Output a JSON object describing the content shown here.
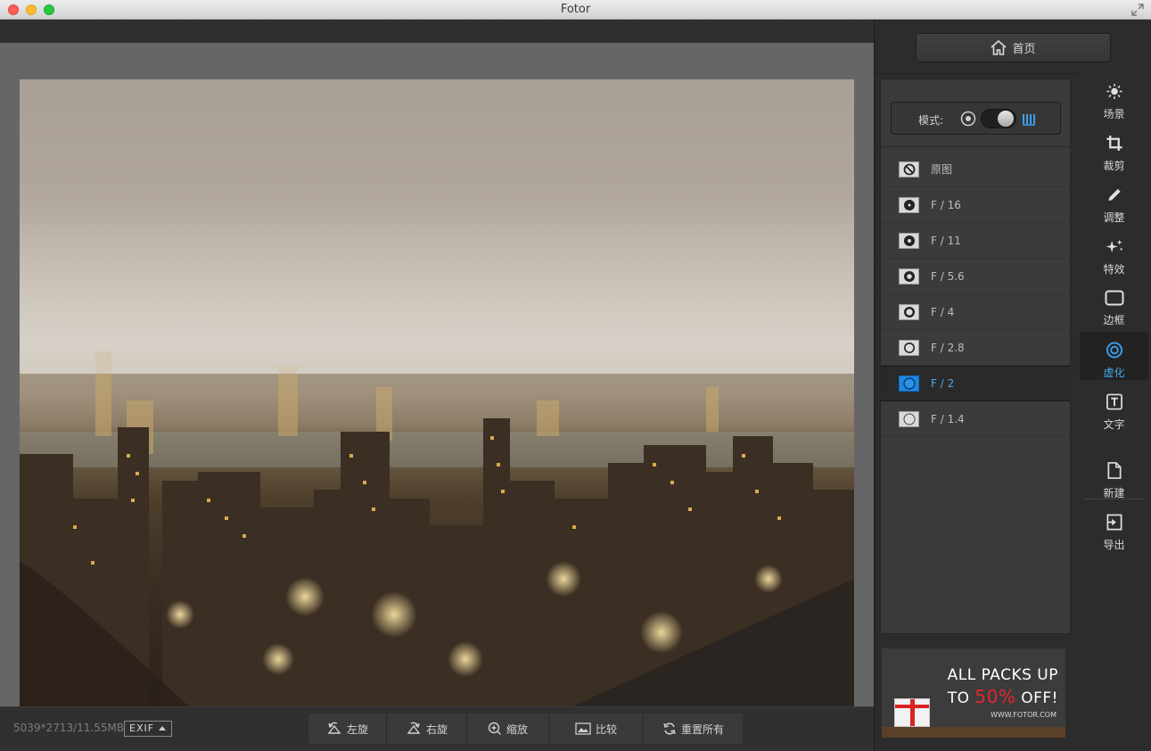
{
  "window": {
    "title": "Fotor"
  },
  "home_button": {
    "label": "首页"
  },
  "mode": {
    "label": "模式:"
  },
  "options": [
    {
      "label": "原图",
      "icon": "no-blur-icon"
    },
    {
      "label": "F / 16",
      "icon": "aperture-icon"
    },
    {
      "label": "F / 11",
      "icon": "aperture-icon"
    },
    {
      "label": "F / 5.6",
      "icon": "aperture-icon"
    },
    {
      "label": "F / 4",
      "icon": "aperture-icon"
    },
    {
      "label": "F / 2.8",
      "icon": "aperture-icon"
    },
    {
      "label": "F / 2",
      "icon": "aperture-icon",
      "active": true
    },
    {
      "label": "F / 1.4",
      "icon": "aperture-icon"
    }
  ],
  "nav": [
    {
      "label": "场景",
      "icon": "sun-icon"
    },
    {
      "label": "裁剪",
      "icon": "crop-icon"
    },
    {
      "label": "调整",
      "icon": "pencil-icon"
    },
    {
      "label": "特效",
      "icon": "sparkle-icon"
    },
    {
      "label": "边框",
      "icon": "frame-icon"
    },
    {
      "label": "虚化",
      "icon": "blur-icon",
      "active": true
    },
    {
      "label": "文字",
      "icon": "text-icon"
    },
    {
      "label": "新建",
      "icon": "new-file-icon"
    },
    {
      "label": "导出",
      "icon": "export-icon"
    }
  ],
  "bottom": {
    "file_info": "5039*2713/11.55MB",
    "exif_label": "EXIF",
    "rotate_left": "左旋",
    "rotate_right": "右旋",
    "zoom": "缩放",
    "compare": "比较",
    "reset_all": "重置所有"
  },
  "promo": {
    "line1": "ALL PACKS UP",
    "line2_prefix": "TO ",
    "line2_highlight": "50%",
    "line2_suffix": " OFF!",
    "url": "WWW.FOTOR.COM"
  },
  "colors": {
    "accent": "#1e88e5",
    "active_text": "#4ba8ee",
    "promo_red": "#e3272c"
  }
}
